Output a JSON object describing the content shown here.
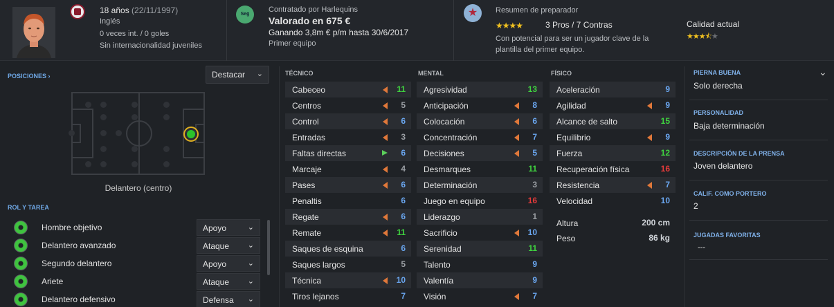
{
  "header": {
    "age": "18 años",
    "dob": "(22/11/1997)",
    "nationality": "Inglés",
    "caps": "0 veces int. / 0 goles",
    "youth_caps": "Sin internacionalidad juveniles",
    "contract_label": "Contratado por Harlequins",
    "value": "Valorado en 675 €",
    "wage": "Ganando 3,8m € p/m hasta 30/6/2017",
    "squad_status": "Primer equipo",
    "seg_badge": "Seg",
    "scout_title": "Resumen de preparador",
    "scout_stars": "★★★★",
    "scout_pros_cons": "3 Pros / 7 Contras",
    "scout_text_1": "Con potencial para ser un jugador clave de la",
    "scout_text_2": "plantilla del primer equipo.",
    "current_ability_label": "Calidad actual",
    "current_ability_stars": "★★★★★",
    "current_ability_value": 3.5,
    "accent": "#6fa8e6"
  },
  "positions": {
    "label": "POSICIONES",
    "chevron": "›",
    "dropdown": "Destacar",
    "caption": "Delantero (centro)"
  },
  "roles": {
    "label": "ROL Y TAREA",
    "items": [
      {
        "name": "Hombre objetivo",
        "duty": "Apoyo"
      },
      {
        "name": "Delantero avanzado",
        "duty": "Ataque"
      },
      {
        "name": "Segundo delantero",
        "duty": "Apoyo"
      },
      {
        "name": "Ariete",
        "duty": "Ataque"
      },
      {
        "name": "Delantero defensivo",
        "duty": "Defensa"
      }
    ]
  },
  "technical": {
    "title": "TÉCNICO",
    "attrs": [
      {
        "name": "Cabeceo",
        "value": "11",
        "color": "green",
        "ind": "orange"
      },
      {
        "name": "Centros",
        "value": "5",
        "color": "grey",
        "ind": "orange"
      },
      {
        "name": "Control",
        "value": "6",
        "color": "blue",
        "ind": "orange"
      },
      {
        "name": "Entradas",
        "value": "3",
        "color": "grey",
        "ind": "orange"
      },
      {
        "name": "Faltas directas",
        "value": "6",
        "color": "blue",
        "ind": "green"
      },
      {
        "name": "Marcaje",
        "value": "4",
        "color": "grey",
        "ind": "orange"
      },
      {
        "name": "Pases",
        "value": "6",
        "color": "blue",
        "ind": "orange"
      },
      {
        "name": "Penaltis",
        "value": "6",
        "color": "blue",
        "ind": ""
      },
      {
        "name": "Regate",
        "value": "6",
        "color": "blue",
        "ind": "orange"
      },
      {
        "name": "Remate",
        "value": "11",
        "color": "green",
        "ind": "orange"
      },
      {
        "name": "Saques de esquina",
        "value": "6",
        "color": "blue",
        "ind": ""
      },
      {
        "name": "Saques largos",
        "value": "5",
        "color": "grey",
        "ind": ""
      },
      {
        "name": "Técnica",
        "value": "10",
        "color": "blue",
        "ind": "orange"
      },
      {
        "name": "Tiros lejanos",
        "value": "7",
        "color": "blue",
        "ind": ""
      }
    ]
  },
  "mental": {
    "title": "MENTAL",
    "attrs": [
      {
        "name": "Agresividad",
        "value": "13",
        "color": "green",
        "ind": ""
      },
      {
        "name": "Anticipación",
        "value": "8",
        "color": "blue",
        "ind": "orange"
      },
      {
        "name": "Colocación",
        "value": "6",
        "color": "blue",
        "ind": "orange"
      },
      {
        "name": "Concentración",
        "value": "7",
        "color": "blue",
        "ind": "orange"
      },
      {
        "name": "Decisiones",
        "value": "5",
        "color": "blue",
        "ind": "orange"
      },
      {
        "name": "Desmarques",
        "value": "11",
        "color": "green",
        "ind": ""
      },
      {
        "name": "Determinación",
        "value": "3",
        "color": "grey",
        "ind": ""
      },
      {
        "name": "Juego en equipo",
        "value": "16",
        "color": "red",
        "ind": ""
      },
      {
        "name": "Liderazgo",
        "value": "1",
        "color": "grey",
        "ind": ""
      },
      {
        "name": "Sacrificio",
        "value": "10",
        "color": "blue",
        "ind": "orange"
      },
      {
        "name": "Serenidad",
        "value": "11",
        "color": "green",
        "ind": ""
      },
      {
        "name": "Talento",
        "value": "9",
        "color": "blue",
        "ind": ""
      },
      {
        "name": "Valentía",
        "value": "9",
        "color": "blue",
        "ind": ""
      },
      {
        "name": "Visión",
        "value": "7",
        "color": "blue",
        "ind": "orange"
      }
    ]
  },
  "physical": {
    "title": "FÍSICO",
    "attrs": [
      {
        "name": "Aceleración",
        "value": "9",
        "color": "blue",
        "ind": ""
      },
      {
        "name": "Agilidad",
        "value": "9",
        "color": "blue",
        "ind": "orange"
      },
      {
        "name": "Alcance de salto",
        "value": "15",
        "color": "green",
        "ind": ""
      },
      {
        "name": "Equilibrio",
        "value": "9",
        "color": "blue",
        "ind": "orange"
      },
      {
        "name": "Fuerza",
        "value": "12",
        "color": "green",
        "ind": ""
      },
      {
        "name": "Recuperación física",
        "value": "16",
        "color": "red",
        "ind": ""
      },
      {
        "name": "Resistencia",
        "value": "7",
        "color": "blue",
        "ind": "orange"
      },
      {
        "name": "Velocidad",
        "value": "10",
        "color": "blue",
        "ind": ""
      }
    ],
    "height_label": "Altura",
    "height_value": "200 cm",
    "weight_label": "Peso",
    "weight_value": "86 kg"
  },
  "info": {
    "foot_label": "PIERNA BUENA",
    "foot_value": "Solo derecha",
    "personality_label": "PERSONALIDAD",
    "personality_value": "Baja determinación",
    "press_label": "DESCRIPCIÓN DE LA PRENSA",
    "press_value": "Joven delantero",
    "gk_label": "CALIF. COMO PORTERO",
    "gk_value": "2",
    "ppm_label": "JUGADAS FAVORITAS",
    "ppm_value": "---"
  }
}
